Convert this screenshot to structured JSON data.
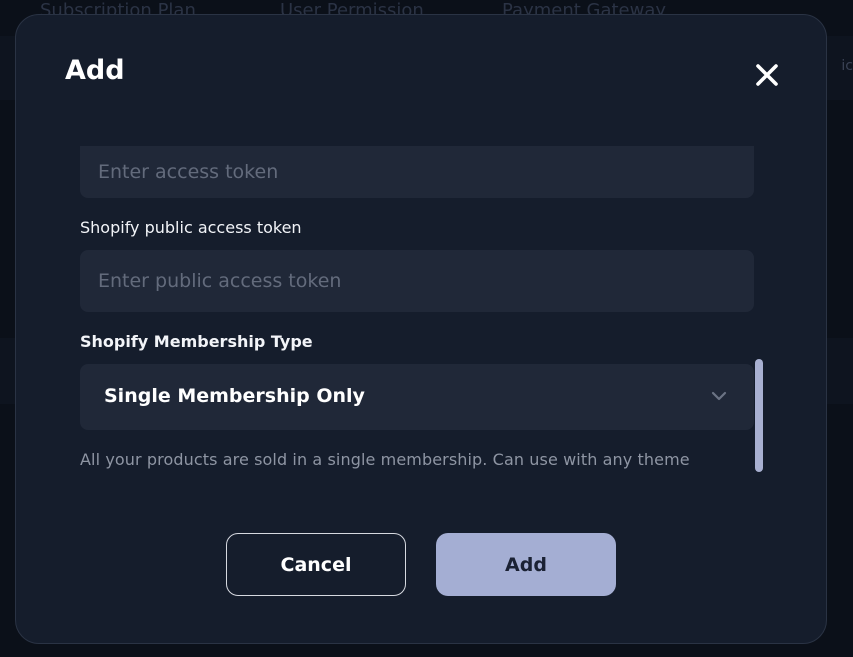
{
  "background": {
    "tabs": [
      "Subscription Plan",
      "User Permission",
      "Payment Gateway"
    ],
    "right_fragment": "ic"
  },
  "modal": {
    "title": "Add",
    "close_icon": "close-icon",
    "access_token": {
      "placeholder": "Enter access token",
      "value": ""
    },
    "public_access_token": {
      "label": "Shopify public access token",
      "placeholder": "Enter public access token",
      "value": ""
    },
    "membership_type": {
      "label": "Shopify Membership Type",
      "selected": "Single Membership Only",
      "chevron_icon": "chevron-down-icon",
      "helper": "All your products are sold in a single membership. Can use with any theme"
    },
    "buttons": {
      "cancel": "Cancel",
      "add": "Add"
    }
  },
  "colors": {
    "modal_bg": "#151d2c",
    "input_bg": "#202838",
    "accent": "#a4aed3"
  }
}
